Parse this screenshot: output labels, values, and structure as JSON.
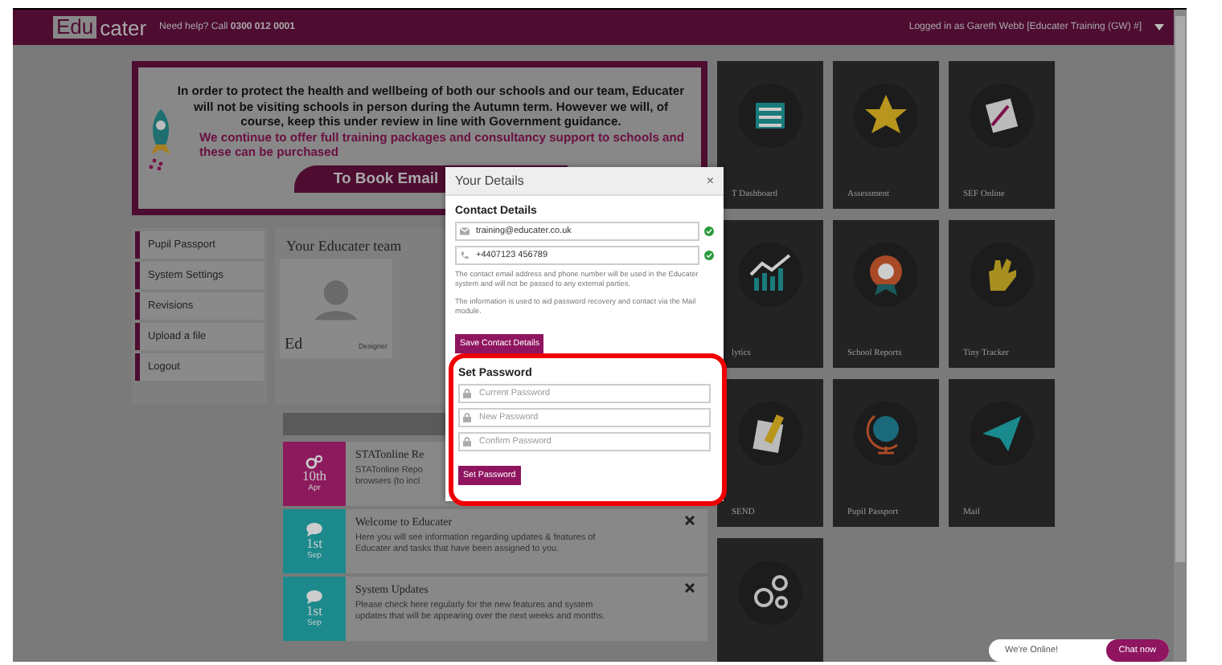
{
  "header": {
    "logo_box": "Edu",
    "logo_rest": "cater",
    "help": "Need help? Call **0300 012 0001**",
    "user": "Logged in as Gareth Webb [Educater Training (GW) #]"
  },
  "banner": {
    "message": "In order to protect the health and wellbeing of both our schools and our team, Educater will not be visiting schools in person during the Autumn term. However we will, of course, keep this under review in line with Government guidance.",
    "offer": "We continue to offer full training packages and consultancy support to schools and these can be purchased",
    "button": "To Book Email"
  },
  "sidebar": {
    "items": [
      {
        "label": "Pupil Passport"
      },
      {
        "label": "System Settings"
      },
      {
        "label": "Revisions"
      },
      {
        "label": "Upload a file"
      },
      {
        "label": "Logout"
      }
    ]
  },
  "team": {
    "title": "Your Educater team",
    "member": {
      "name": "Ed",
      "role": "Designer"
    }
  },
  "news": [
    {
      "kind": "gears",
      "color": "#8c1a5c",
      "day": "10th",
      "month": "Apr",
      "title": "STATonline Re",
      "lines": [
        "STATonline Repo",
        "browsers (to incl"
      ],
      "closable": false
    },
    {
      "kind": "chat",
      "color": "#1c8a8c",
      "day": "1st",
      "month": "Sep",
      "title": "Welcome to Educater",
      "lines": [
        "Here you will see information regarding updates & features of",
        "Educater and tasks that have been assigned to you."
      ],
      "closable": true
    },
    {
      "kind": "chat",
      "color": "#1c8a8c",
      "day": "1st",
      "month": "Sep",
      "title": "System Updates",
      "lines": [
        "Please check here regularly for the new features and system",
        "updates that will be appearing over the next weeks and months."
      ],
      "closable": true
    }
  ],
  "tiles": [
    {
      "kind": "building",
      "label": "T Dashboard"
    },
    {
      "kind": "star",
      "label": "Assessment"
    },
    {
      "kind": "papers",
      "label": "SEF Online"
    },
    {
      "kind": "chart",
      "label": "lytics"
    },
    {
      "kind": "rosette",
      "label": "School Reports"
    },
    {
      "kind": "hand",
      "label": "Tiny Tracker"
    },
    {
      "kind": "pencil",
      "label": "SEND"
    },
    {
      "kind": "globe",
      "label": "Pupil Passport"
    },
    {
      "kind": "plane",
      "label": "Mail"
    },
    {
      "kind": "gears"
    }
  ],
  "modal": {
    "title": "Your Details",
    "close": "×",
    "contact_heading": "Contact Details",
    "email": "training@educater.co.uk",
    "email_valid": true,
    "phone": "+4407123 456789",
    "phone_valid": true,
    "notes": [
      "The contact email address and phone number will be used in the Educater system and will not be passed to any external parties.",
      "The information is used to aid password recovery and contact via the Mail module."
    ],
    "save_button": "Save Contact Details",
    "password_heading": "Set Password",
    "password_fields": [
      {
        "placeholder": "Current Password"
      },
      {
        "placeholder": "New Password"
      },
      {
        "placeholder": "Confirm Password"
      }
    ],
    "set_button": "Set Password"
  },
  "chat": {
    "status": "We're Online!",
    "button": "Chat now"
  }
}
